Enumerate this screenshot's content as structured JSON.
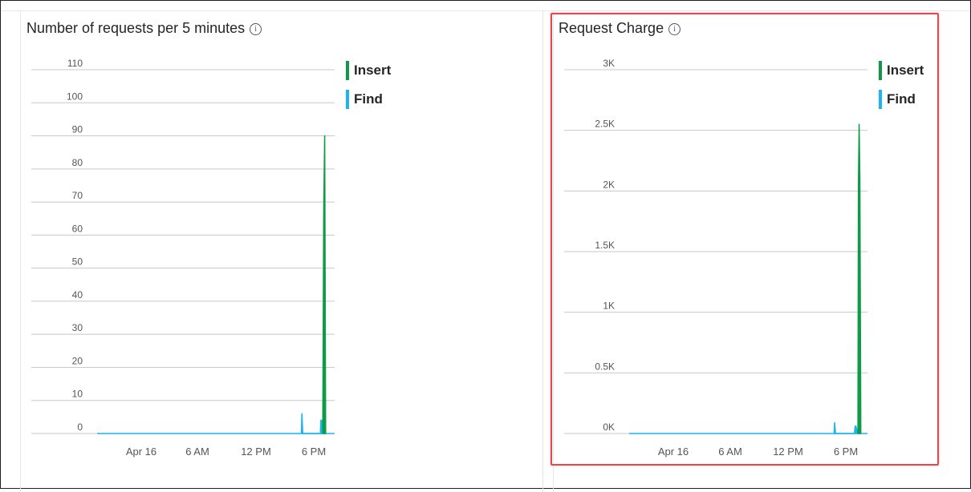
{
  "colors": {
    "insert": "#0e9a47",
    "find": "#1ab4ee",
    "grid": "#c8c8c8",
    "axis_text": "#555555",
    "highlight": "#e8474f"
  },
  "chart_data": [
    {
      "type": "line",
      "title": "Number of requests per 5 minutes",
      "info_icon": "info-icon",
      "x_ticks": [
        "Apr 16",
        "6 AM",
        "12 PM",
        "6 PM"
      ],
      "y_ticks": [
        "0",
        "10",
        "20",
        "30",
        "40",
        "50",
        "60",
        "70",
        "80",
        "90",
        "100",
        "110"
      ],
      "ylim": [
        0,
        110
      ],
      "grid": true,
      "legend_position": "right",
      "series": [
        {
          "name": "Insert",
          "color_key": "insert",
          "points": [
            [
              0.95,
              0
            ],
            [
              0.954,
              67
            ],
            [
              0.958,
              90
            ],
            [
              0.962,
              0
            ]
          ]
        },
        {
          "name": "Find",
          "color_key": "find",
          "points": [
            [
              0.86,
              0
            ],
            [
              0.862,
              6
            ],
            [
              0.866,
              0
            ],
            [
              0.94,
              0
            ],
            [
              0.942,
              4
            ],
            [
              0.946,
              4
            ],
            [
              0.95,
              4
            ],
            [
              0.952,
              0
            ]
          ]
        }
      ]
    },
    {
      "type": "line",
      "title": "Request Charge",
      "info_icon": "info-icon",
      "x_ticks": [
        "Apr 16",
        "6 AM",
        "12 PM",
        "6 PM"
      ],
      "y_ticks": [
        "0K",
        "0.5K",
        "1K",
        "1.5K",
        "2K",
        "2.5K",
        "3K"
      ],
      "ylim": [
        0,
        3000
      ],
      "grid": true,
      "legend_position": "right",
      "highlighted": true,
      "series": [
        {
          "name": "Insert",
          "color_key": "insert",
          "points": [
            [
              0.96,
              0
            ],
            [
              0.962,
              2050
            ],
            [
              0.965,
              2550
            ],
            [
              0.968,
              2120
            ],
            [
              0.972,
              0
            ]
          ]
        },
        {
          "name": "Find",
          "color_key": "find",
          "points": [
            [
              0.86,
              0
            ],
            [
              0.862,
              90
            ],
            [
              0.866,
              0
            ],
            [
              0.945,
              0
            ],
            [
              0.948,
              60
            ],
            [
              0.952,
              60
            ],
            [
              0.958,
              0
            ]
          ]
        }
      ]
    }
  ]
}
